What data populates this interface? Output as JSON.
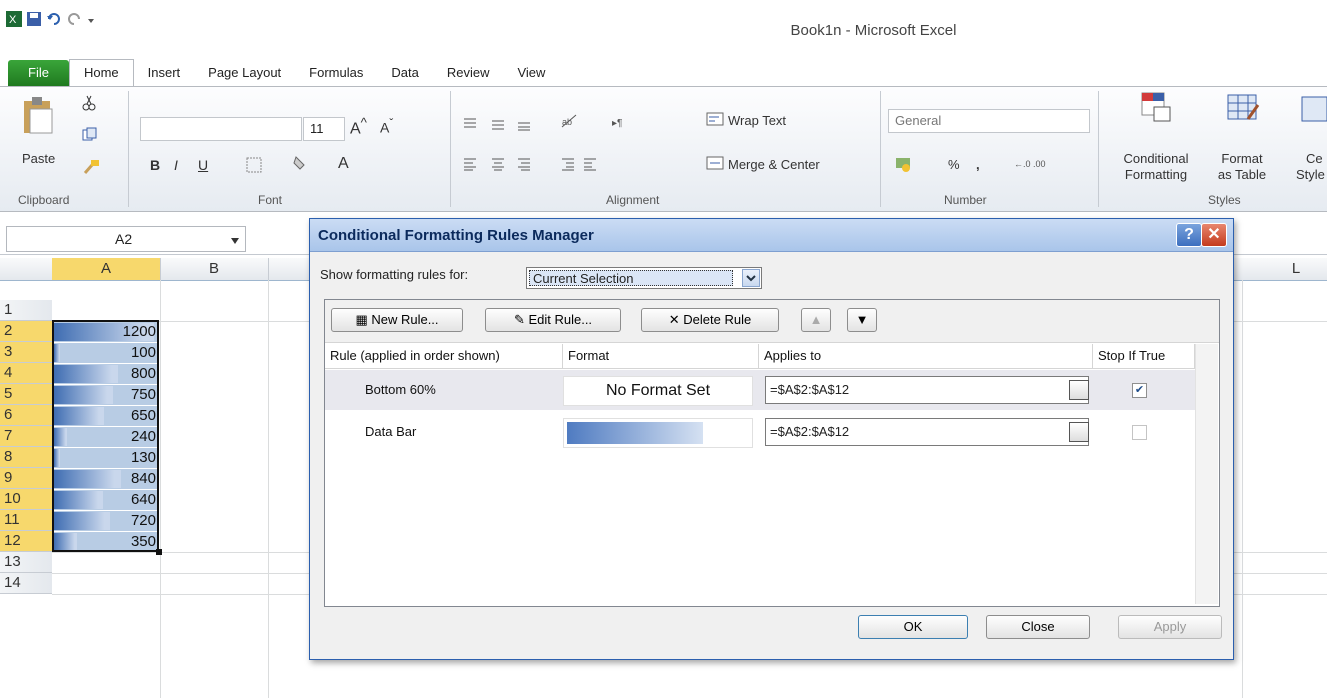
{
  "window": {
    "title": "Book1n  -  Microsoft Excel"
  },
  "tabs": [
    "File",
    "Home",
    "Insert",
    "Page Layout",
    "Formulas",
    "Data",
    "Review",
    "View"
  ],
  "ribbon": {
    "paste_label": "Paste",
    "font_size": "11",
    "wrap_text": "Wrap Text",
    "merge_center": "Merge & Center",
    "number_format": "General",
    "conditional_formatting": [
      "Conditional",
      "Formatting"
    ],
    "format_as_table": [
      "Format",
      "as Table"
    ],
    "cell_styles": [
      "Ce",
      "Style"
    ],
    "groups": [
      "Clipboard",
      "Font",
      "Alignment",
      "Number",
      "Styles"
    ],
    "bold": "B",
    "italic": "I",
    "underline": "U",
    "percent": "%",
    "comma": ","
  },
  "namebox": "A2",
  "columns": [
    "A",
    "B",
    "L"
  ],
  "rows": [
    "1",
    "2",
    "3",
    "4",
    "5",
    "6",
    "7",
    "8",
    "9",
    "10",
    "11",
    "12",
    "13",
    "14"
  ],
  "cells": [
    {
      "row": "2",
      "value": "1200",
      "bar": 1.0
    },
    {
      "row": "3",
      "value": "100",
      "bar": 0.0
    },
    {
      "row": "4",
      "value": "800",
      "bar": 0.64
    },
    {
      "row": "5",
      "value": "750",
      "bar": 0.59
    },
    {
      "row": "6",
      "value": "650",
      "bar": 0.5
    },
    {
      "row": "7",
      "value": "240",
      "bar": 0.13
    },
    {
      "row": "8",
      "value": "130",
      "bar": 0.03
    },
    {
      "row": "9",
      "value": "840",
      "bar": 0.67
    },
    {
      "row": "10",
      "value": "640",
      "bar": 0.49
    },
    {
      "row": "11",
      "value": "720",
      "bar": 0.56
    },
    {
      "row": "12",
      "value": "350",
      "bar": 0.23
    }
  ],
  "dialog": {
    "title": "Conditional Formatting Rules Manager",
    "show_rules_label": "Show formatting rules for:",
    "show_rules_value": "Current Selection",
    "new_rule": "New Rule...",
    "edit_rule": "Edit Rule...",
    "delete_rule": "Delete Rule",
    "headers": {
      "rule": "Rule (applied in order shown)",
      "format": "Format",
      "applies": "Applies to",
      "stop": "Stop If True"
    },
    "rules": [
      {
        "name": "Bottom 60%",
        "format": "No Format Set",
        "applies": "=$A$2:$A$12",
        "stop": true
      },
      {
        "name": "Data Bar",
        "format": "",
        "applies": "=$A$2:$A$12",
        "stop": false
      }
    ],
    "ok": "OK",
    "close": "Close",
    "apply": "Apply"
  }
}
